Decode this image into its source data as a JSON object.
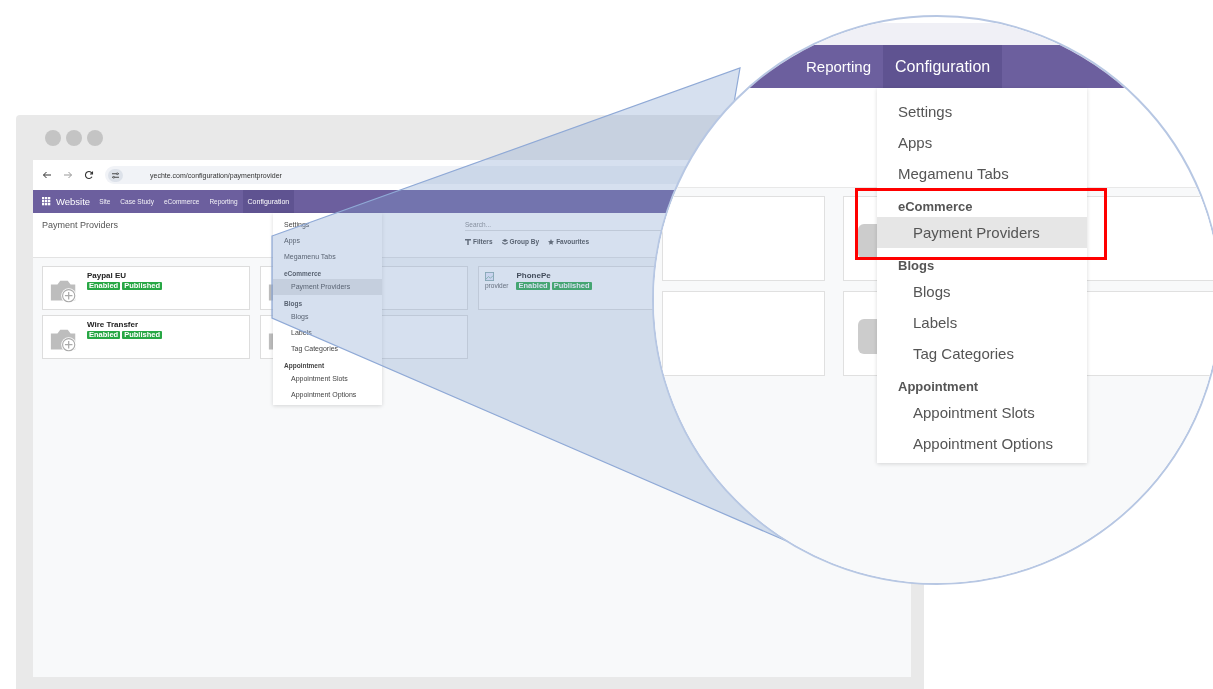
{
  "browser": {
    "url": "yechte.com/configuration/paymentprovider"
  },
  "app_name": "Website",
  "nav": [
    {
      "label": "Site",
      "selected": false
    },
    {
      "label": "Case Study",
      "selected": false
    },
    {
      "label": "eCommerce",
      "selected": false
    },
    {
      "label": "Reporting",
      "selected": false
    },
    {
      "label": "Configuration",
      "selected": true
    }
  ],
  "page_title": "Payment Providers",
  "search": {
    "placeholder": "Search..."
  },
  "filters": [
    {
      "kind": "filter",
      "label": "Filters"
    },
    {
      "kind": "group",
      "label": "Group By"
    },
    {
      "kind": "favourite",
      "label": "Favourites"
    }
  ],
  "cards": [
    {
      "name": "Paypal EU",
      "kind": "camera",
      "badges": [
        "Enabled",
        "Published"
      ]
    },
    {
      "kind": "camera"
    },
    {
      "name": "PhonePe",
      "kind": "broken",
      "alt": "provider",
      "badges": [
        "Enabled",
        "Published"
      ]
    },
    {
      "name": "Wire Transfer",
      "kind": "camera",
      "badges": [
        "Enabled",
        "Published"
      ]
    },
    {
      "kind": "camera"
    }
  ],
  "menu": [
    {
      "label": "Settings",
      "selected": false
    },
    {
      "label": "Apps",
      "selected": false
    },
    {
      "label": "Megamenu Tabs",
      "selected": false
    },
    {
      "label": "eCommerce",
      "children": [
        {
          "label": "Payment Providers",
          "selected": true
        }
      ]
    },
    {
      "label": "Blogs",
      "children": [
        {
          "label": "Blogs",
          "selected": false
        },
        {
          "label": "Labels",
          "selected": false
        },
        {
          "label": "Tag Categories",
          "selected": false
        }
      ]
    },
    {
      "label": "Appointment",
      "children": [
        {
          "label": "Appointment Slots",
          "selected": false
        },
        {
          "label": "Appointment Options",
          "selected": false
        }
      ]
    }
  ],
  "zoom": {
    "nav": [
      {
        "label": "Reporting",
        "selected": false
      },
      {
        "label": "Configuration",
        "selected": true
      }
    ],
    "menu": [
      {
        "label": "Settings",
        "selected": false
      },
      {
        "label": "Apps",
        "selected": false
      },
      {
        "label": "Megamenu Tabs",
        "selected": false
      },
      {
        "label": "eCommerce",
        "highlighted": true,
        "children": [
          {
            "label": "Payment Providers",
            "selected": true
          }
        ]
      },
      {
        "label": "Blogs",
        "highlighted": false,
        "children": [
          {
            "label": "Blogs",
            "selected": false
          },
          {
            "label": "Labels",
            "selected": false
          },
          {
            "label": "Tag Categories",
            "selected": false
          }
        ]
      },
      {
        "label": "Appointment",
        "highlighted": false,
        "children": [
          {
            "label": "Appointment Slots",
            "selected": false
          },
          {
            "label": "Appointment Options",
            "selected": false
          }
        ]
      }
    ]
  }
}
